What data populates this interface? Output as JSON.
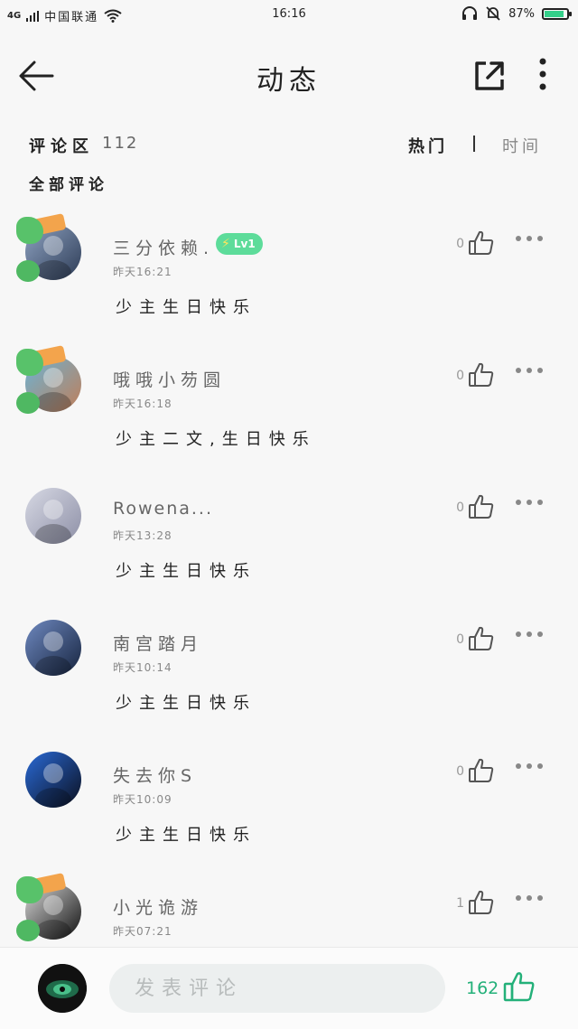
{
  "status_bar": {
    "network": "4G",
    "carrier": "中国联通",
    "time": "16:16",
    "battery_percent": "87%",
    "battery_level": 0.87,
    "icons": [
      "signal-icon",
      "wifi-icon",
      "headset-icon",
      "mute-bell-icon",
      "battery-icon"
    ]
  },
  "header": {
    "title": "动态",
    "icons": [
      "back-arrow-icon",
      "share-icon",
      "more-vertical-icon"
    ]
  },
  "comments_header": {
    "label": "评论区",
    "count": "112",
    "tab_hot": "热门",
    "tab_time": "时间",
    "all_label": "全部评论"
  },
  "comments": [
    {
      "username": "三分依赖.",
      "badge": "Lv1",
      "time": "昨天16:21",
      "text": "少主生日快乐",
      "likes": "0",
      "frame": true
    },
    {
      "username": "哦哦小芴圆",
      "time": "昨天16:18",
      "text": "少主二文,生日快乐",
      "likes": "0",
      "frame": true
    },
    {
      "username": "Rowena...",
      "time": "昨天13:28",
      "text": "少主生日快乐",
      "likes": "0",
      "frame": false
    },
    {
      "username": "南宫踏月",
      "time": "昨天10:14",
      "text": "少主生日快乐",
      "likes": "0",
      "frame": false
    },
    {
      "username": "失去你S",
      "time": "昨天10:09",
      "text": "少主生日快乐",
      "likes": "0",
      "frame": false
    },
    {
      "username": "小光诡游",
      "time": "昨天07:21",
      "text": "",
      "likes": "1",
      "frame": true
    }
  ],
  "bottom_bar": {
    "input_placeholder": "发表评论",
    "total_likes": "162"
  },
  "colors": {
    "accent": "#23b079",
    "badge": "#5ddc9a",
    "background": "#f7f7f7"
  }
}
